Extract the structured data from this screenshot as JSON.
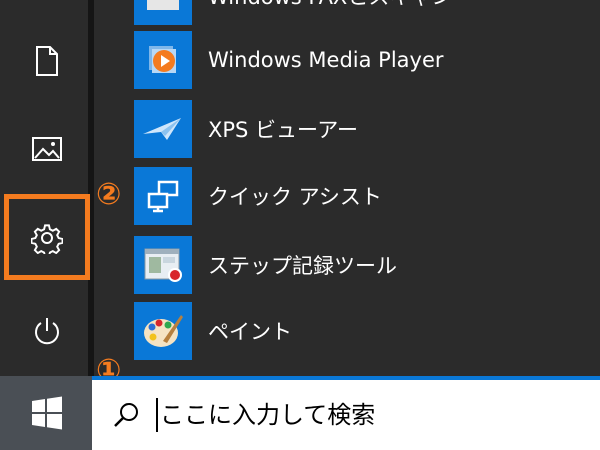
{
  "start_menu": {
    "rail": {
      "items": [
        {
          "icon": "document-icon"
        },
        {
          "icon": "pictures-icon"
        },
        {
          "icon": "gear-icon"
        },
        {
          "icon": "power-icon"
        }
      ]
    },
    "apps": [
      {
        "label": "Windows FAXとスキャン",
        "icon": "fax-scanner-icon"
      },
      {
        "label": "Windows Media Player",
        "icon": "media-player-icon"
      },
      {
        "label": "XPS ビューアー",
        "icon": "xps-viewer-icon"
      },
      {
        "label": "クイック アシスト",
        "icon": "quick-assist-icon"
      },
      {
        "label": "ステップ記録ツール",
        "icon": "steps-recorder-icon"
      },
      {
        "label": "ペイント",
        "icon": "paint-icon"
      }
    ]
  },
  "annotations": {
    "marker_1": "①",
    "marker_2": "②",
    "color": "#f47b1f"
  },
  "taskbar": {
    "start_icon": "windows-logo-icon",
    "search": {
      "icon": "search-icon",
      "placeholder": "ここに入力して検索",
      "value": ""
    }
  },
  "colors": {
    "tile_blue": "#0a78d7",
    "menu_bg": "#2b2b2b",
    "taskbar_bg": "#1b1b1b",
    "start_btn_bg": "#4a4f55"
  }
}
